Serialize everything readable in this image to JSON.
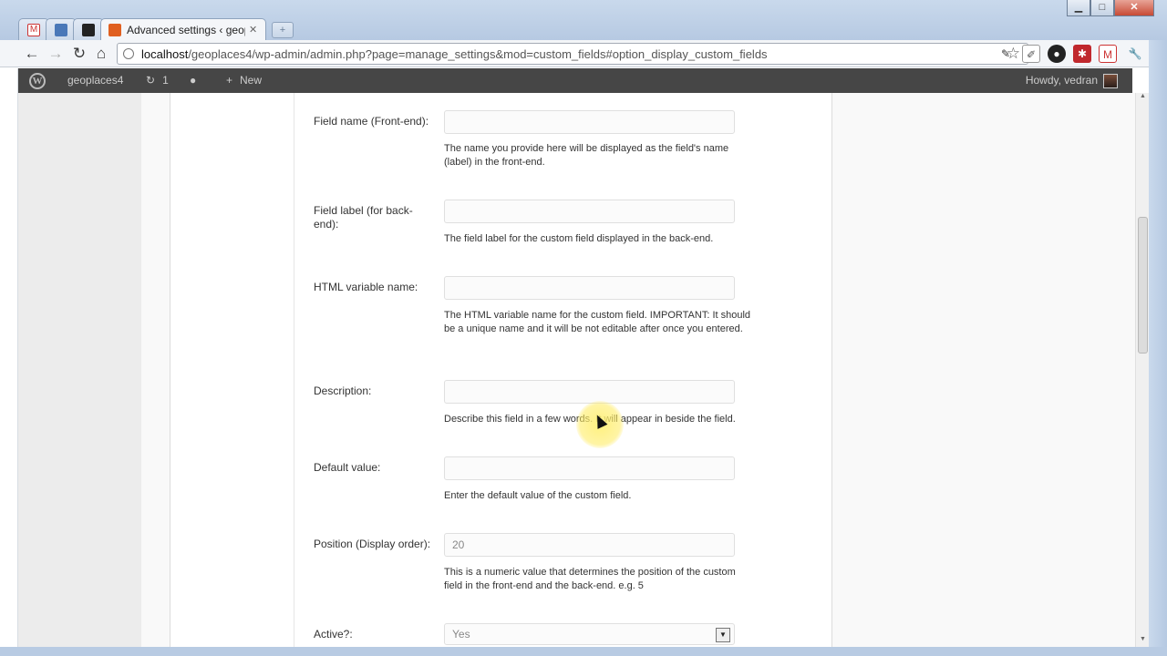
{
  "browser": {
    "active_tab_title": "Advanced settings ‹ geopla",
    "url_host": "localhost",
    "url_path": "/geoplaces4/wp-admin/admin.php?page=manage_settings&mod=custom_fields#option_display_custom_fields"
  },
  "adminbar": {
    "site_name": "geoplaces4",
    "updates_count": "1",
    "new_label": "New",
    "howdy": "Howdy, vedran"
  },
  "fields": [
    {
      "label": "Field name (Front-end):",
      "value": "",
      "description": "The name you provide here will be displayed as the field's name (label) in the front-end."
    },
    {
      "label": "Field label (for back-end):",
      "value": "",
      "description": "The field label for the custom field displayed in the back-end."
    },
    {
      "label": "HTML variable name:",
      "value": "",
      "description": "The HTML variable name for the custom field. IMPORTANT: It should be a unique name and it will be not editable after once you entered."
    },
    {
      "label": "Description:",
      "value": "",
      "description": "Describe this field in a few words. It will appear in beside the field."
    },
    {
      "label": "Default value:",
      "value": "",
      "description": "Enter the default value of the custom field."
    },
    {
      "label": "Position (Display order):",
      "value": "20",
      "description": "This is a numeric value that determines the position of the custom field in the front-end and the back-end. e.g. 5"
    },
    {
      "label": "Active?:",
      "value": "Yes"
    }
  ],
  "colors": {
    "adminbar_bg": "#464646",
    "chrome_bg": "#c9d9ec"
  }
}
